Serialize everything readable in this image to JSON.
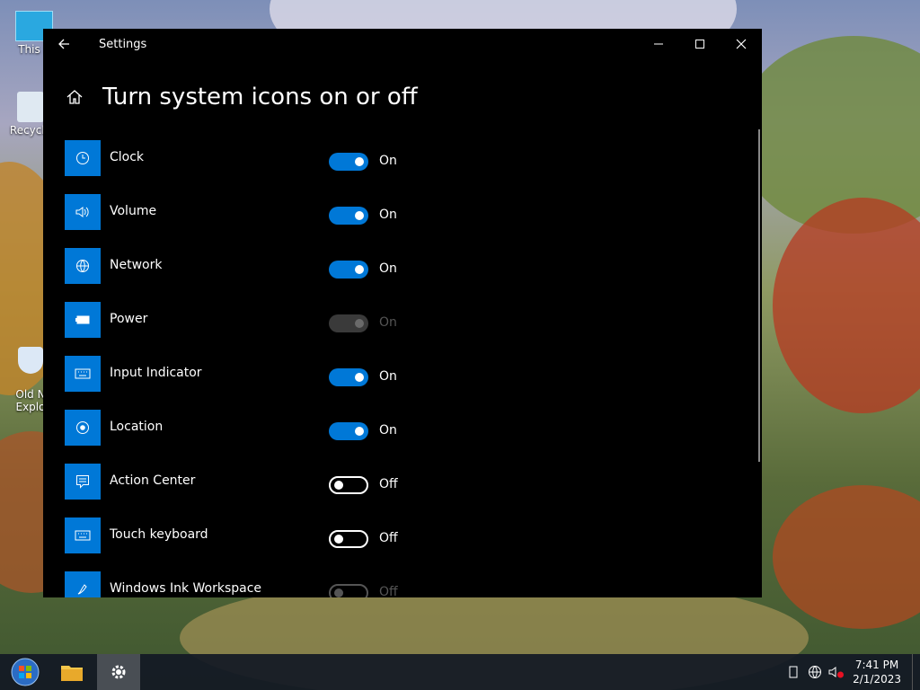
{
  "window": {
    "title": "Settings",
    "page_title": "Turn system icons on or off"
  },
  "items": [
    {
      "label": "Clock",
      "state": "On",
      "mode": "on",
      "icon": "clock-icon"
    },
    {
      "label": "Volume",
      "state": "On",
      "mode": "on",
      "icon": "volume-icon"
    },
    {
      "label": "Network",
      "state": "On",
      "mode": "on",
      "icon": "network-globe-icon"
    },
    {
      "label": "Power",
      "state": "On",
      "mode": "disabled",
      "icon": "battery-icon"
    },
    {
      "label": "Input Indicator",
      "state": "On",
      "mode": "on",
      "icon": "keyboard-icon"
    },
    {
      "label": "Location",
      "state": "On",
      "mode": "on",
      "icon": "location-icon"
    },
    {
      "label": "Action Center",
      "state": "Off",
      "mode": "off",
      "icon": "action-center-icon"
    },
    {
      "label": "Touch keyboard",
      "state": "Off",
      "mode": "off",
      "icon": "touch-keyboard-icon"
    },
    {
      "label": "Windows Ink Workspace",
      "state": "Off",
      "mode": "offdim",
      "icon": "pen-icon"
    }
  ],
  "desktop": {
    "icons": [
      {
        "label": "This P"
      },
      {
        "label": "Recycle"
      },
      {
        "label": "Old N\nExplo"
      }
    ]
  },
  "taskbar": {
    "time": "7:41 PM",
    "date": "2/1/2023"
  },
  "colors": {
    "accent": "#0078d7",
    "window_bg": "#000000"
  }
}
